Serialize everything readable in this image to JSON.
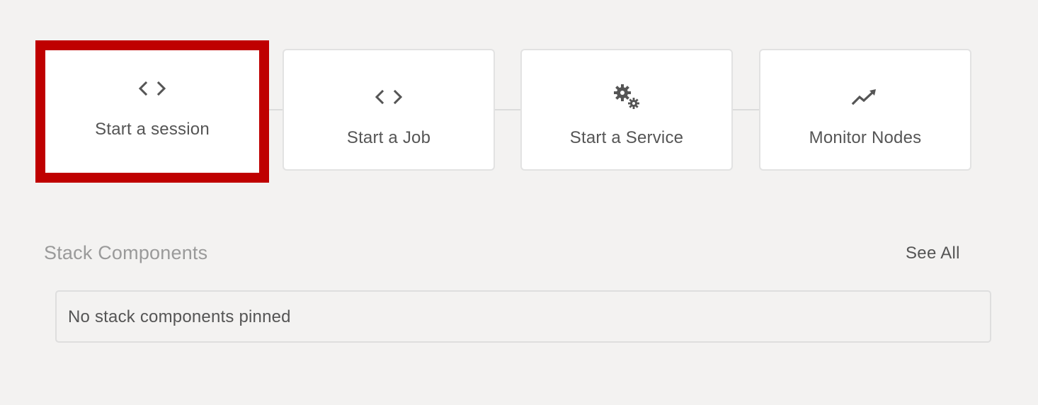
{
  "actions": [
    {
      "label": "Start a session",
      "icon": "code-icon"
    },
    {
      "label": "Start a Job",
      "icon": "code-icon"
    },
    {
      "label": "Start a Service",
      "icon": "gears-icon"
    },
    {
      "label": "Monitor Nodes",
      "icon": "trend-line-icon"
    }
  ],
  "stack_components": {
    "title": "Stack Components",
    "see_all_label": "See All",
    "empty_message": "No stack components pinned"
  },
  "colors": {
    "highlight": "#bf0000",
    "background": "#f3f2f1",
    "text": "#555555",
    "muted_text": "#9a9a9a"
  }
}
